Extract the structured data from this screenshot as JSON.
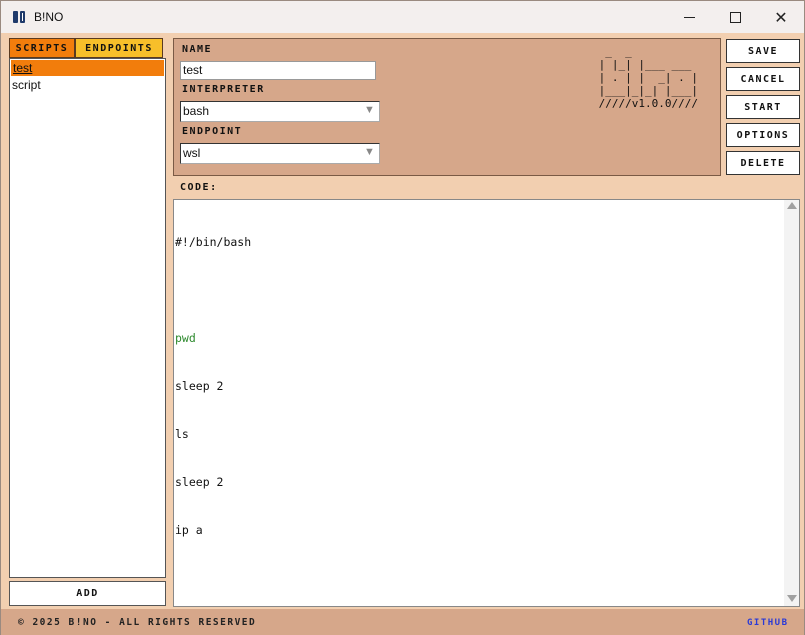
{
  "window": {
    "title": "B!NO"
  },
  "tabs": {
    "scripts": "SCRIPTS",
    "endpoints": "ENDPOINTS"
  },
  "scripts_list": [
    {
      "label": "test",
      "selected": true
    },
    {
      "label": "script",
      "selected": false
    }
  ],
  "add_button": "ADD",
  "form": {
    "name_label": "NAME",
    "name_value": "test",
    "interpreter_label": "INTERPRETER",
    "interpreter_value": "bash",
    "endpoint_label": "ENDPOINT",
    "endpoint_value": "wsl"
  },
  "logo_ascii": "  _  _\n | |_| |___ ___\n | . | |  _| . |\n |___|_|_| |___|\n /////v1.0.0////",
  "actions": {
    "save": "SAVE",
    "cancel": "CANCEL",
    "start": "START",
    "options": "OPTIONS",
    "delete": "DELETE"
  },
  "code": {
    "label": "CODE:",
    "lines": [
      "#!/bin/bash",
      "",
      "pwd",
      "sleep 2",
      "ls",
      "sleep 2",
      "ip a"
    ]
  },
  "footer": {
    "copyright": "© 2025 B!NO - ALL RIGHTS RESERVED",
    "github": "GITHUB"
  },
  "colors": {
    "accent_orange": "#f27d0c",
    "accent_yellow": "#f7bf2a",
    "panel_bg": "#d6a78a",
    "window_bg": "#f2cfb0",
    "link_blue": "#2a3ad6",
    "code_green": "#2e8a2e"
  }
}
